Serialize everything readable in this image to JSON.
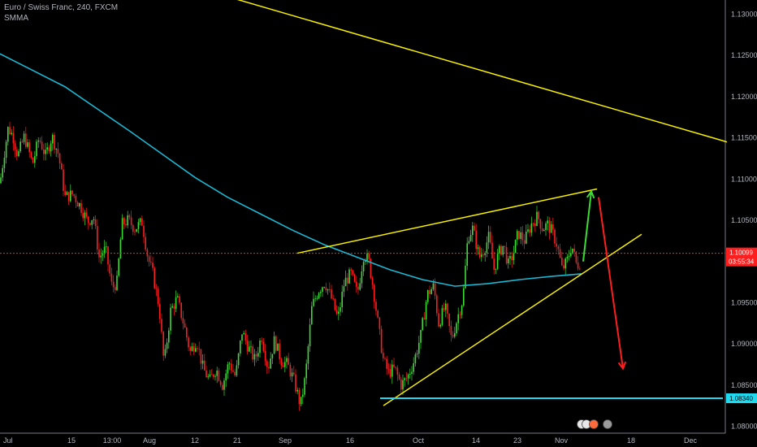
{
  "header": {
    "title": "Euro / Swiss Franc, 240, FXCM",
    "indicator": "SMMA"
  },
  "chart_data": {
    "type": "candlestick",
    "symbol": "EURCHF",
    "timeframe": "240",
    "ylim": [
      1.077,
      1.133
    ],
    "y_ticks": [
      "1.13000",
      "1.12500",
      "1.12000",
      "1.11500",
      "1.11000",
      "1.10500",
      "1.10000",
      "1.09500",
      "1.09000",
      "1.08500",
      "1.08000"
    ],
    "x_ticks": [
      "Jul",
      "15",
      "13:00",
      "Aug",
      "12",
      "21",
      "Sep",
      "16",
      "Oct",
      "14",
      "23",
      "Nov",
      "18",
      "Dec"
    ],
    "price_path": [
      [
        0,
        1.1095
      ],
      [
        5,
        1.113
      ],
      [
        10,
        1.1162
      ],
      [
        16,
        1.1152
      ],
      [
        22,
        1.1128
      ],
      [
        30,
        1.1152
      ],
      [
        40,
        1.1118
      ],
      [
        48,
        1.115
      ],
      [
        56,
        1.1128
      ],
      [
        64,
        1.1152
      ],
      [
        72,
        1.113
      ],
      [
        80,
        1.1078
      ],
      [
        90,
        1.1082
      ],
      [
        100,
        1.1065
      ],
      [
        108,
        1.1048
      ],
      [
        115,
        1.1055
      ],
      [
        122,
        1.1005
      ],
      [
        130,
        1.1015
      ],
      [
        138,
        1.0968
      ],
      [
        144,
        1.0975
      ],
      [
        150,
        1.1045
      ],
      [
        158,
        1.105
      ],
      [
        166,
        1.104
      ],
      [
        175,
        1.1048
      ],
      [
        182,
        1.1005
      ],
      [
        188,
        1.0985
      ],
      [
        196,
        1.0945
      ],
      [
        202,
        1.0875
      ],
      [
        210,
        1.094
      ],
      [
        218,
        1.0955
      ],
      [
        226,
        1.0925
      ],
      [
        234,
        1.089
      ],
      [
        242,
        1.0905
      ],
      [
        250,
        1.087
      ],
      [
        258,
        1.0855
      ],
      [
        266,
        1.087
      ],
      [
        274,
        1.085
      ],
      [
        282,
        1.0878
      ],
      [
        290,
        1.086
      ],
      [
        298,
        1.0915
      ],
      [
        306,
        1.0895
      ],
      [
        314,
        1.088
      ],
      [
        322,
        1.091
      ],
      [
        330,
        1.087
      ],
      [
        338,
        1.0905
      ],
      [
        346,
        1.088
      ],
      [
        354,
        1.0875
      ],
      [
        362,
        1.0855
      ],
      [
        370,
        1.0825
      ],
      [
        376,
        1.086
      ],
      [
        384,
        1.0945
      ],
      [
        392,
        1.0965
      ],
      [
        400,
        1.0975
      ],
      [
        408,
        1.0955
      ],
      [
        416,
        1.093
      ],
      [
        424,
        1.0975
      ],
      [
        432,
        1.0985
      ],
      [
        440,
        1.096
      ],
      [
        448,
        1.101
      ],
      [
        454,
        1.1
      ],
      [
        460,
        1.0965
      ],
      [
        466,
        1.092
      ],
      [
        472,
        1.088
      ],
      [
        478,
        1.0865
      ],
      [
        486,
        1.087
      ],
      [
        494,
        1.085
      ],
      [
        502,
        1.086
      ],
      [
        510,
        1.088
      ],
      [
        518,
        1.091
      ],
      [
        526,
        1.096
      ],
      [
        534,
        1.097
      ],
      [
        540,
        1.0925
      ],
      [
        548,
        1.0945
      ],
      [
        556,
        1.0905
      ],
      [
        564,
        1.0935
      ],
      [
        570,
        1.0955
      ],
      [
        576,
        1.103
      ],
      [
        582,
        1.104
      ],
      [
        590,
        1.1005
      ],
      [
        596,
        1.1015
      ],
      [
        602,
        1.103
      ],
      [
        608,
        1.099
      ],
      [
        614,
        1.101
      ],
      [
        620,
        1.102
      ],
      [
        626,
        1.0995
      ],
      [
        632,
        1.101
      ],
      [
        638,
        1.1035
      ],
      [
        646,
        1.1025
      ],
      [
        654,
        1.1045
      ],
      [
        662,
        1.1055
      ],
      [
        668,
        1.104
      ],
      [
        674,
        1.1045
      ],
      [
        680,
        1.1035
      ],
      [
        686,
        1.102
      ],
      [
        692,
        1.099
      ],
      [
        698,
        1.1
      ],
      [
        704,
        1.102
      ],
      [
        710,
        1.0995
      ],
      [
        716,
        1.1
      ]
    ],
    "smma_path": [
      [
        0,
        1.1252
      ],
      [
        40,
        1.1232
      ],
      [
        80,
        1.1212
      ],
      [
        120,
        1.1185
      ],
      [
        160,
        1.1158
      ],
      [
        200,
        1.113
      ],
      [
        240,
        1.1102
      ],
      [
        280,
        1.1078
      ],
      [
        320,
        1.1058
      ],
      [
        360,
        1.1038
      ],
      [
        400,
        1.102
      ],
      [
        440,
        1.1005
      ],
      [
        480,
        1.099
      ],
      [
        520,
        1.0978
      ],
      [
        560,
        1.097
      ],
      [
        600,
        1.0973
      ],
      [
        640,
        1.0978
      ],
      [
        680,
        1.0982
      ],
      [
        716,
        1.0985
      ]
    ],
    "drawings": [
      {
        "kind": "trendline",
        "color": "#f7ef00",
        "from": [
          250,
          1.133
        ],
        "to": [
          895,
          1.1145
        ]
      },
      {
        "kind": "trendline",
        "color": "#f7ef00",
        "from": [
          366,
          1.101
        ],
        "to": [
          735,
          1.1088
        ]
      },
      {
        "kind": "trendline",
        "color": "#f7ef00",
        "from": [
          472,
          1.0825
        ],
        "to": [
          790,
          1.1033
        ]
      },
      {
        "kind": "hline",
        "color": "#1ed9f0",
        "from": [
          468,
          1.0834
        ],
        "to": [
          890,
          1.0834
        ]
      },
      {
        "kind": "arrow",
        "color": "#3ddc35",
        "from": [
          718,
          1.1
        ],
        "to": [
          728,
          1.1085
        ]
      },
      {
        "kind": "arrow",
        "color": "#ff1e1e",
        "from": [
          737,
          1.1078
        ],
        "to": [
          767,
          1.087
        ]
      }
    ],
    "current_price": "1.10099",
    "countdown": "03:55:34",
    "support_level": "1.08340",
    "colors": {
      "up": "#3ddc35",
      "down": "#ff1e1e",
      "smma": "#1bb8d4",
      "trendline": "#f7ef00",
      "support": "#1ed9f0",
      "price_line": "#ff2a2a",
      "background": "#000000"
    }
  }
}
